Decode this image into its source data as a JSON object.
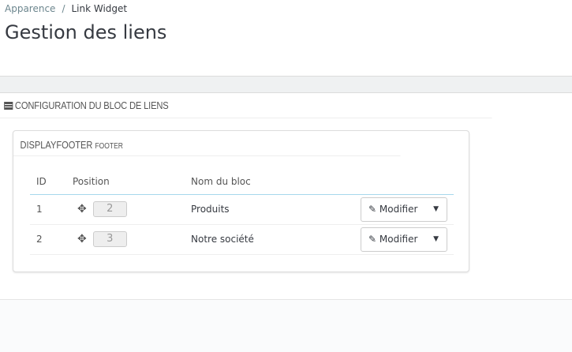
{
  "breadcrumb": {
    "parent": "Apparence",
    "separator": "/",
    "current": "Link Widget"
  },
  "page_title": "Gestion des liens",
  "section": {
    "title": "CONFIGURATION DU BLOC DE LIENS"
  },
  "panel": {
    "hook": "DISPLAYFOOTER",
    "hook_sub": "FOOTER",
    "columns": [
      "ID",
      "Position",
      "Nom du bloc"
    ],
    "rows": [
      {
        "id": "1",
        "position": "2",
        "name": "Produits",
        "action": "Modifier"
      },
      {
        "id": "2",
        "position": "3",
        "name": "Notre société",
        "action": "Modifier"
      }
    ]
  }
}
